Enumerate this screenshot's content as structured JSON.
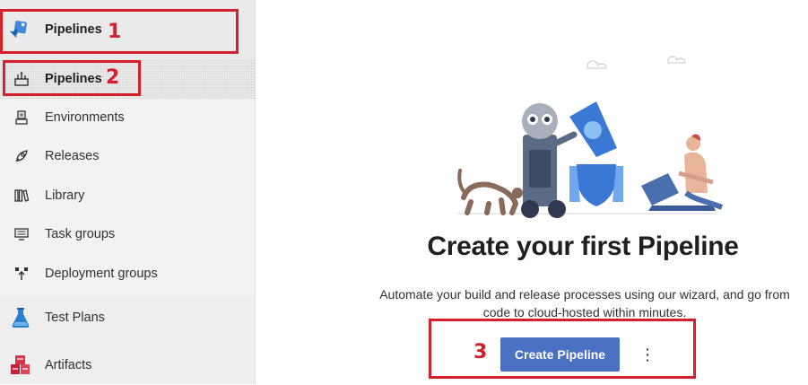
{
  "sidebar": {
    "top_item": {
      "label": "Pipelines",
      "icon": "pipelines-icon"
    },
    "sub_items": [
      {
        "label": "Pipelines",
        "icon": "pipelines-sub-icon"
      },
      {
        "label": "Environments",
        "icon": "environments-icon"
      },
      {
        "label": "Releases",
        "icon": "releases-icon"
      },
      {
        "label": "Library",
        "icon": "library-icon"
      },
      {
        "label": "Task groups",
        "icon": "task-groups-icon"
      },
      {
        "label": "Deployment groups",
        "icon": "deployment-groups-icon"
      }
    ],
    "bottom_items": [
      {
        "label": "Test Plans",
        "icon": "test-plans-icon"
      },
      {
        "label": "Artifacts",
        "icon": "artifacts-icon"
      }
    ]
  },
  "main": {
    "title": "Create your first Pipeline",
    "description_line1": "Automate your build and release processes using our wizard, and go from",
    "description_line2": "code to cloud-hosted within minutes.",
    "primary_button": "Create Pipeline",
    "more_button": "⋮"
  },
  "annotations": {
    "num1": "1",
    "num2": "2",
    "num3": "3"
  },
  "colors": {
    "accent": "#4a70c4",
    "annotation": "#d4202a",
    "sidebar_bg": "#f3f2f1"
  }
}
